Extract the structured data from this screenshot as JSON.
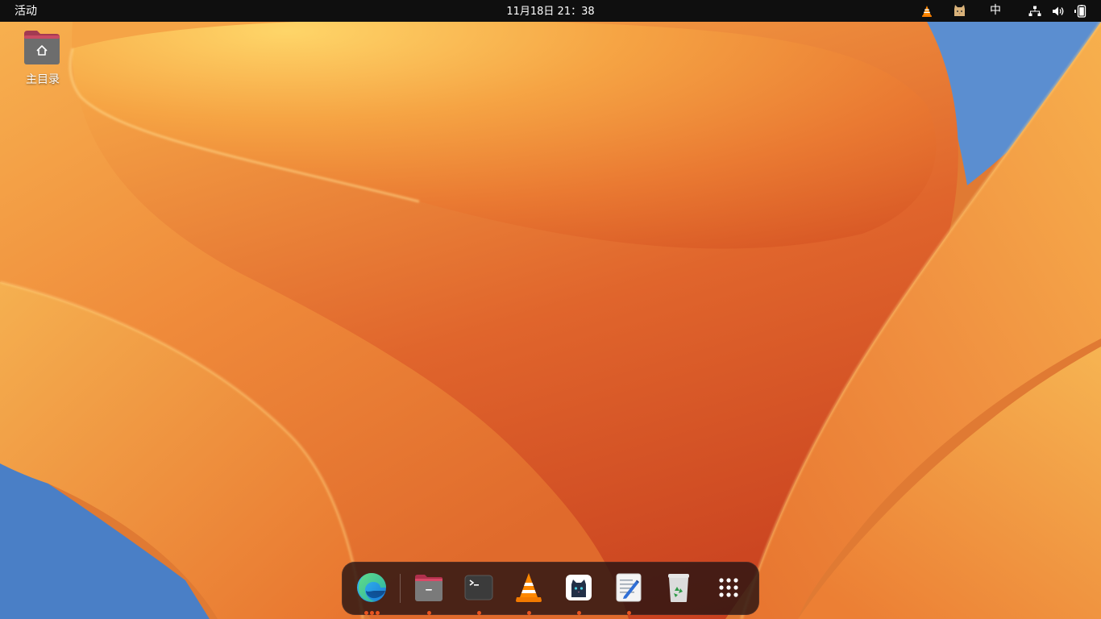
{
  "topbar": {
    "activities": "活动",
    "clock": "11月18日  21：38",
    "ime": "中"
  },
  "tray_icons": [
    "vlc-icon",
    "cat-icon",
    "network-icon",
    "volume-icon",
    "battery-icon"
  ],
  "desktop": {
    "icons": [
      {
        "label": "主目录",
        "icon": "home-folder-icon"
      }
    ]
  },
  "dock": {
    "items": [
      {
        "name": "microsoft-edge",
        "icon": "edge-icon",
        "running_dots": 3
      },
      {
        "name": "files",
        "icon": "files-icon",
        "running_dots": 1
      },
      {
        "name": "terminal",
        "icon": "terminal-icon",
        "running_dots": 1
      },
      {
        "name": "vlc",
        "icon": "vlc-icon",
        "running_dots": 1
      },
      {
        "name": "cat-app",
        "icon": "cat-app-icon",
        "running_dots": 1
      },
      {
        "name": "text-editor",
        "icon": "text-editor-icon",
        "running_dots": 1
      },
      {
        "name": "trash",
        "icon": "trash-icon",
        "running_dots": 0
      },
      {
        "name": "show-applications",
        "icon": "app-grid-icon",
        "running_dots": 0
      }
    ]
  },
  "colors": {
    "topbar_bg": "#0f0f0f",
    "accent": "#e95420",
    "wallpaper_main": "#f08a30",
    "wallpaper_sky": "#4b82c8"
  }
}
